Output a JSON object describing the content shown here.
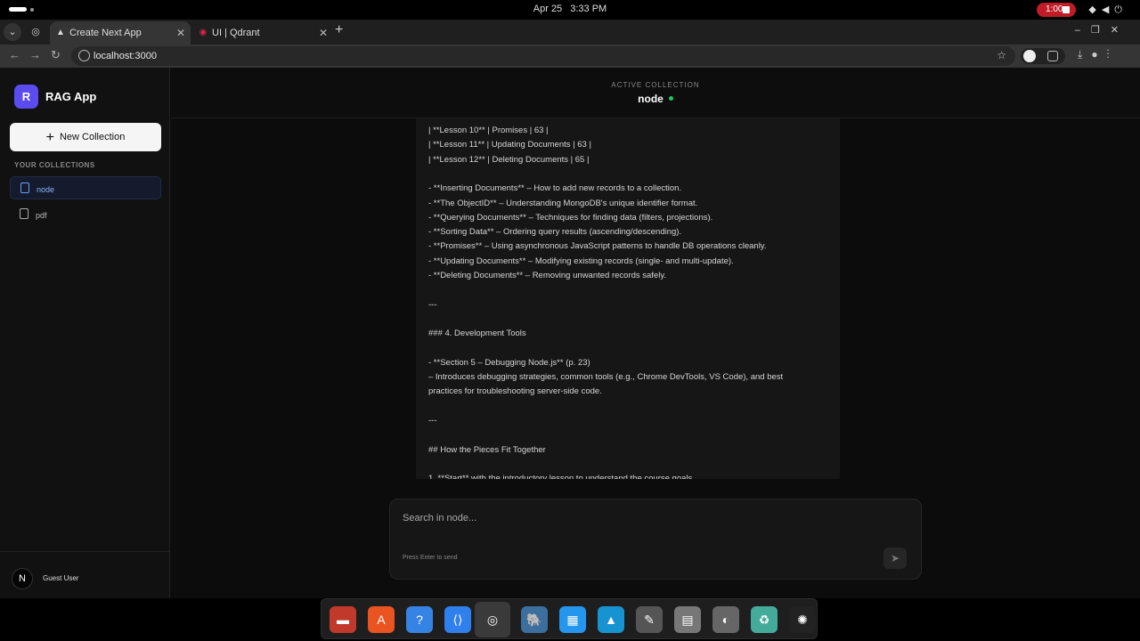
{
  "system_bar": {
    "date": "Apr 25",
    "time": "3:33 PM",
    "record_time": "1:00"
  },
  "browser": {
    "tabs": [
      {
        "title": "Create Next App",
        "active": true
      },
      {
        "title": "UI | Qdrant",
        "active": false
      }
    ],
    "url": "localhost:3000"
  },
  "sidebar": {
    "logo_letter": "R",
    "app_name": "RAG App",
    "new_collection_label": "New Collection",
    "section_label": "YOUR COLLECTIONS",
    "collections": [
      {
        "name": "node",
        "selected": true
      },
      {
        "name": "pdf",
        "selected": false
      }
    ],
    "user": {
      "avatar_letter": "N",
      "name": "Guest User"
    }
  },
  "header": {
    "label": "ACTIVE COLLECTION",
    "collection": "node"
  },
  "message_lines": [
    "| **Lesson 10** | Promises | 63 |",
    "| **Lesson 11** | Updating Documents | 63 |",
    "| **Lesson 12** | Deleting Documents | 65 |",
    "",
    "- **Inserting Documents** – How to add new records to a collection.",
    "- **The ObjectID** – Understanding MongoDB's unique identifier format.",
    "- **Querying Documents** – Techniques for finding data (filters, projections).",
    "- **Sorting Data** – Ordering query results (ascending/descending).",
    "- **Promises** – Using asynchronous JavaScript patterns to handle DB operations cleanly.",
    "- **Updating Documents** – Modifying existing records (single- and multi-update).",
    "- **Deleting Documents** – Removing unwanted records safely.",
    "",
    "---",
    "",
    "### 4. Development Tools",
    "",
    "- **Section 5 – Debugging Node.js** (p. 23)",
    "  – Introduces debugging strategies, common tools (e.g., Chrome DevTools, VS Code), and best",
    "practices for troubleshooting server-side code.",
    "",
    "---",
    "",
    "## How the Pieces Fit Together",
    "",
    "1. **Start** with the introductory lesson to understand the course goals."
  ],
  "composer": {
    "placeholder": "Search in node...",
    "hint": "Press Enter to send"
  },
  "dock": {
    "apps": [
      "files-icon",
      "app-center-icon",
      "help-icon",
      "vscode-icon",
      "chrome-icon",
      "postgres-icon",
      "docker-icon",
      "arch-icon",
      "notes-icon",
      "office-icon",
      "disk-icon",
      "trash-icon",
      "ubuntu-icon"
    ]
  }
}
